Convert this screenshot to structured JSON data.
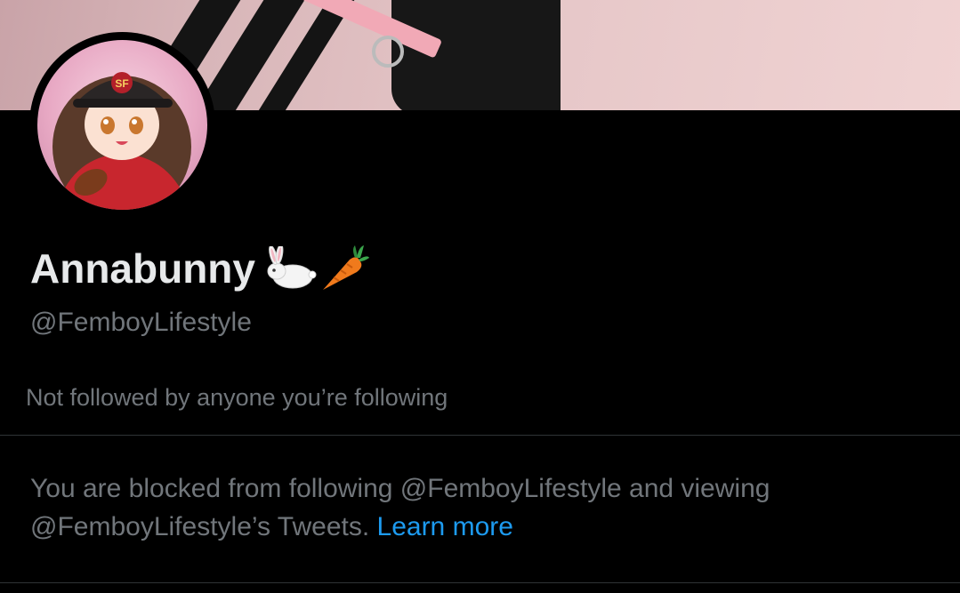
{
  "profile": {
    "display_name": "Annabunny",
    "name_emojis": [
      "rabbit-emoji",
      "carrot-emoji"
    ],
    "handle": "@FemboyLifestyle",
    "followed_by_text": "Not followed by anyone you’re following"
  },
  "blocked_notice": {
    "line1": "You are blocked from following @FemboyLifestyle and viewing",
    "line2": "@FemboyLifestyle’s Tweets.",
    "link_label": "Learn more"
  },
  "colors": {
    "background": "#000000",
    "primary_text": "#e7e9ea",
    "secondary_text": "#71767b",
    "link": "#1d9bf0",
    "divider": "#2f3336"
  }
}
